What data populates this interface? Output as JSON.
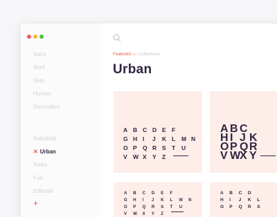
{
  "window": {
    "controls": [
      {
        "name": "close",
        "color": "#f25d58"
      },
      {
        "name": "minimize",
        "color": "#f8bb2f"
      },
      {
        "name": "maximize",
        "color": "#4fc43d"
      }
    ]
  },
  "sidebar": {
    "categories": [
      "Sans",
      "Serif",
      "Slab",
      "Human",
      "Decorative"
    ],
    "collections": [
      "Industrial",
      "Urban",
      "Retro",
      "Fun",
      "Editorial"
    ],
    "active_collection": "Urban",
    "active_marker": "✕",
    "add_label": "+"
  },
  "breadcrumb": {
    "featured": "Featured",
    "separator": "—",
    "collections": "Collections"
  },
  "page_title": "Urban",
  "cards": [
    {
      "rows": [
        [
          "A",
          "B",
          "C",
          "D",
          "E",
          "F"
        ],
        [
          "G",
          "H",
          "I",
          "J",
          "K",
          "L",
          "M",
          "N"
        ],
        [
          "O",
          "P",
          "Q",
          "R",
          "S",
          "T",
          "U"
        ],
        [
          "V",
          "W",
          "X",
          "Y",
          "Z"
        ]
      ]
    },
    {
      "rows": [
        [
          "A",
          "B",
          "C"
        ],
        [
          "H",
          "I",
          "J",
          "K"
        ],
        [
          "O",
          "P",
          "Q",
          "R"
        ],
        [
          "V",
          "W",
          "X",
          "Y"
        ]
      ]
    },
    {
      "rows": [
        [
          "A",
          "B",
          "C",
          "D",
          "E",
          "F"
        ],
        [
          "G",
          "H",
          "I",
          "J",
          "K",
          "L",
          "M",
          "N"
        ],
        [
          "O",
          "P",
          "Q",
          "R",
          "S",
          "T",
          "U"
        ],
        [
          "V",
          "W",
          "X",
          "Y",
          "Z"
        ]
      ]
    },
    {
      "rows": [
        [
          "A",
          "B",
          "C",
          "D"
        ],
        [
          "H",
          "I",
          "J",
          "K",
          "L"
        ],
        [
          "O",
          "P",
          "Q",
          "R",
          "S"
        ]
      ]
    }
  ],
  "colors": {
    "accent": "#e9573f",
    "ink": "#2f2540",
    "card_bg": "#fdeee9"
  }
}
